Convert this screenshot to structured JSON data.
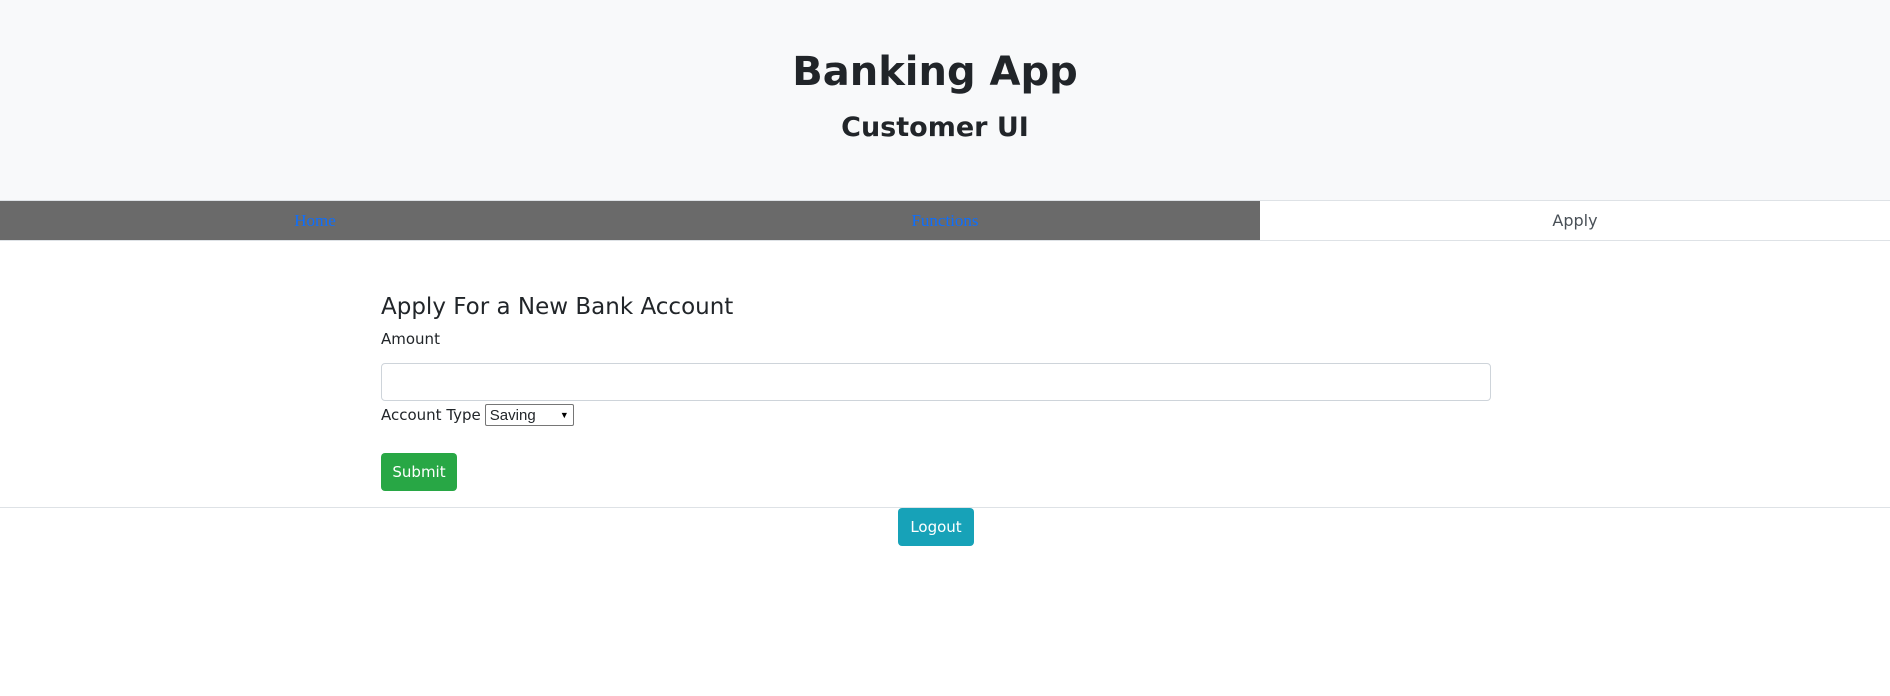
{
  "header": {
    "title": "Banking App",
    "subtitle": "Customer UI"
  },
  "tabs": [
    {
      "label": "Home",
      "active": false
    },
    {
      "label": "Functions",
      "active": false
    },
    {
      "label": "Apply",
      "active": true
    }
  ],
  "form": {
    "title": "Apply For a New Bank Account",
    "amount_label": "Amount",
    "amount_value": "",
    "account_type_label": "Account Type",
    "account_type_selected": "Saving",
    "submit_label": "Submit"
  },
  "footer": {
    "logout_label": "Logout"
  },
  "colors": {
    "header_bg": "#f8f9fa",
    "tab_inactive_bg": "#6a6a6a",
    "link": "#0d6efd",
    "submit": "#28a745",
    "logout": "#17a2b8"
  }
}
